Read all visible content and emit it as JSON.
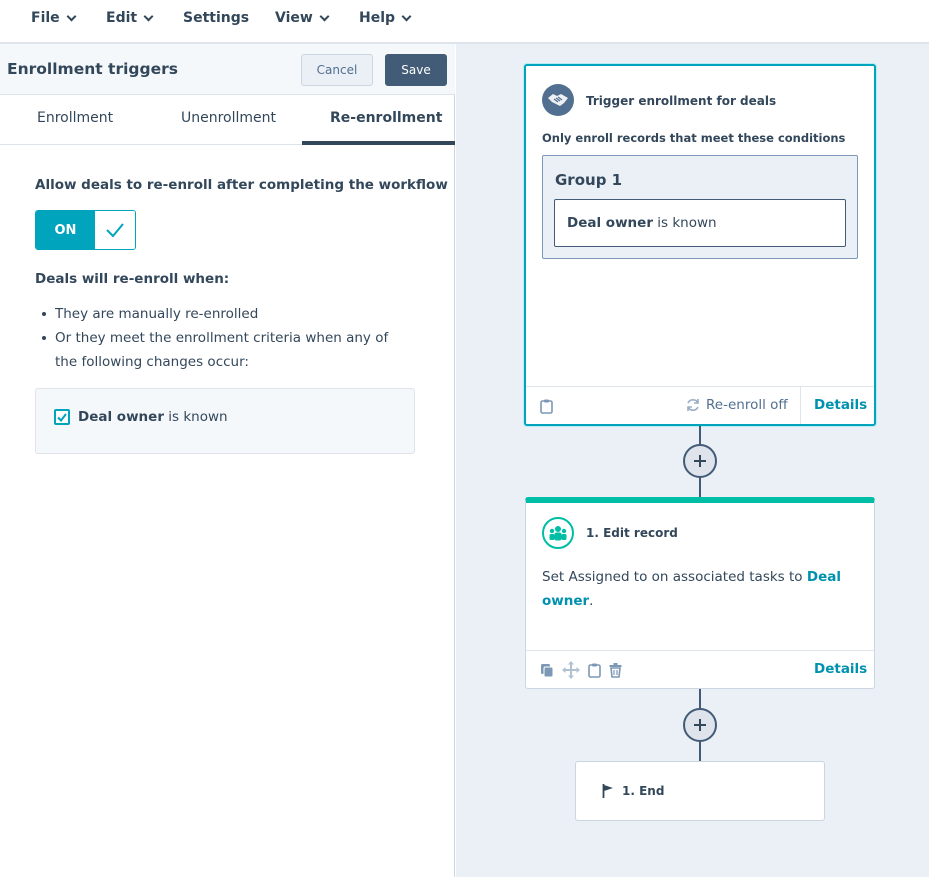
{
  "menu": {
    "file": "File",
    "edit": "Edit",
    "settings": "Settings",
    "view": "View",
    "help": "Help"
  },
  "panel": {
    "title": "Enrollment triggers",
    "cancel_label": "Cancel",
    "save_label": "Save",
    "tabs": [
      {
        "label": "Enrollment"
      },
      {
        "label": "Unenrollment"
      },
      {
        "label": "Re-enrollment"
      }
    ],
    "allow_heading": "Allow deals to re-enroll after completing the workflow",
    "toggle_label": "ON",
    "reenroll_heading": "Deals will re-enroll when:",
    "bullets": [
      "They are manually re-enrolled",
      "Or they meet the enrollment criteria when any of the following changes occur:"
    ],
    "criteria": {
      "property": "Deal owner",
      "condition": " is known",
      "checked": true
    }
  },
  "trigger_card": {
    "title": "Trigger enrollment for deals",
    "subtitle": "Only enroll records that meet these conditions",
    "group_title": "Group 1",
    "condition_property": "Deal owner",
    "condition_text": " is known",
    "reenroll_status": "Re-enroll off",
    "details_label": "Details",
    "icon": "handshake-icon"
  },
  "action_card": {
    "title": "1. Edit record",
    "body_prefix": "Set Assigned to on associated tasks to ",
    "body_link": "Deal owner",
    "body_suffix": ".",
    "details_label": "Details",
    "icon": "people-icon"
  },
  "end_card": {
    "label": "1. End",
    "icon": "flag-icon"
  },
  "colors": {
    "accent": "#00a4bd",
    "action_accent": "#00bda5",
    "text": "#33475b",
    "link": "#0091ae",
    "canvas_bg": "#eaf0f6",
    "save_bg": "#425b76"
  }
}
